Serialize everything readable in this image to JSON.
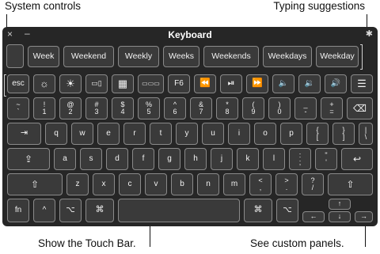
{
  "callouts": {
    "system_controls": "System controls",
    "typing_suggestions": "Typing suggestions",
    "touch_bar": "Show the Touch Bar.",
    "custom_panels": "See custom panels."
  },
  "window": {
    "close": "×",
    "minimize": "–",
    "title": "Keyboard",
    "gear": "✱"
  },
  "suggestions": [
    "Week",
    "Weekend",
    "Weekly",
    "Weeks",
    "Weekends",
    "Weekdays",
    "Weekday"
  ],
  "fnrow": {
    "esc": "esc",
    "bright_down": "☼",
    "bright_up": "☀",
    "mission": "▭▯",
    "launchpad": "▦",
    "touchbar": "▭▭▭",
    "f6": "F6",
    "rewind": "⏪",
    "playpause": "⏯",
    "ffwd": "⏩",
    "mute": "🔈",
    "vol_down": "🔉",
    "vol_up": "🔊",
    "panels": "☰"
  },
  "numrow": [
    {
      "t": "~",
      "b": "`"
    },
    {
      "t": "!",
      "b": "1"
    },
    {
      "t": "@",
      "b": "2"
    },
    {
      "t": "#",
      "b": "3"
    },
    {
      "t": "$",
      "b": "4"
    },
    {
      "t": "%",
      "b": "5"
    },
    {
      "t": "^",
      "b": "6"
    },
    {
      "t": "&",
      "b": "7"
    },
    {
      "t": "*",
      "b": "8"
    },
    {
      "t": "(",
      "b": "9"
    },
    {
      "t": ")",
      "b": "0"
    },
    {
      "t": "_",
      "b": "-"
    },
    {
      "t": "+",
      "b": "="
    }
  ],
  "delete": "⌫",
  "row_q": {
    "tab": "⇥",
    "letters": [
      "q",
      "w",
      "e",
      "r",
      "t",
      "y",
      "u",
      "i",
      "o",
      "p"
    ],
    "lbrace": {
      "t": "{",
      "b": "["
    },
    "rbrace": {
      "t": "}",
      "b": "]"
    },
    "pipe": {
      "t": "|",
      "b": "\\"
    }
  },
  "row_a": {
    "caps": "⇪",
    "letters": [
      "a",
      "s",
      "d",
      "f",
      "g",
      "h",
      "j",
      "k",
      "l"
    ],
    "semi": {
      "t": ":",
      "b": ";"
    },
    "quote": {
      "t": "\"",
      "b": "'"
    },
    "return": "↩"
  },
  "row_z": {
    "shift_l": "⇧",
    "letters": [
      "z",
      "x",
      "c",
      "v",
      "b",
      "n",
      "m"
    ],
    "comma": {
      "t": "<",
      "b": ","
    },
    "period": {
      "t": ">",
      "b": "."
    },
    "slash": {
      "t": "?",
      "b": "/"
    },
    "shift_r": "⇧"
  },
  "row_bottom": {
    "fn": "fn",
    "ctrl": "^",
    "opt_l": "⌥",
    "cmd_l": "⌘",
    "space": "",
    "cmd_r": "⌘",
    "opt_r": "⌥",
    "up": "↑",
    "left": "←",
    "down": "↓",
    "right": "→"
  }
}
